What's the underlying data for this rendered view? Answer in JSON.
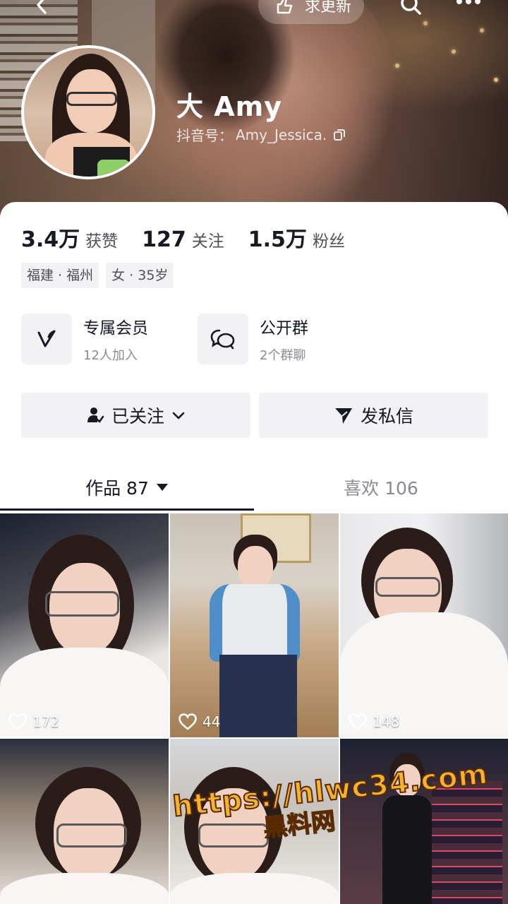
{
  "header": {
    "update_label": "求更新",
    "display_name": "大 Amy",
    "douyin_id_label": "抖音号：",
    "douyin_id": "Amy_Jessica."
  },
  "stats": [
    {
      "value": "3.4万",
      "label": "获赞"
    },
    {
      "value": "127",
      "label": "关注"
    },
    {
      "value": "1.5万",
      "label": "粉丝"
    }
  ],
  "tags": [
    "福建 · 福州",
    "女 · 35岁"
  ],
  "features": [
    {
      "icon": "v-logo-icon",
      "title": "专属会员",
      "sub": "12人加入"
    },
    {
      "icon": "group-chat-icon",
      "title": "公开群",
      "sub": "2个群聊"
    }
  ],
  "actions": {
    "follow_label": "已关注",
    "message_label": "发私信"
  },
  "tabs": {
    "works_label": "作品 87",
    "likes_label": "喜欢 106"
  },
  "grid": [
    {
      "likes": "172"
    },
    {
      "likes": "44"
    },
    {
      "likes": "148"
    },
    {
      "likes": ""
    },
    {
      "likes": ""
    },
    {
      "likes": ""
    }
  ],
  "watermark": {
    "url": "https://hlwc34.com",
    "site": "黑料网"
  },
  "colors": {
    "text_primary": "#161823",
    "text_secondary": "#8a8b91",
    "button_bg": "#f2f2f4",
    "watermark": "#f5b22d"
  }
}
